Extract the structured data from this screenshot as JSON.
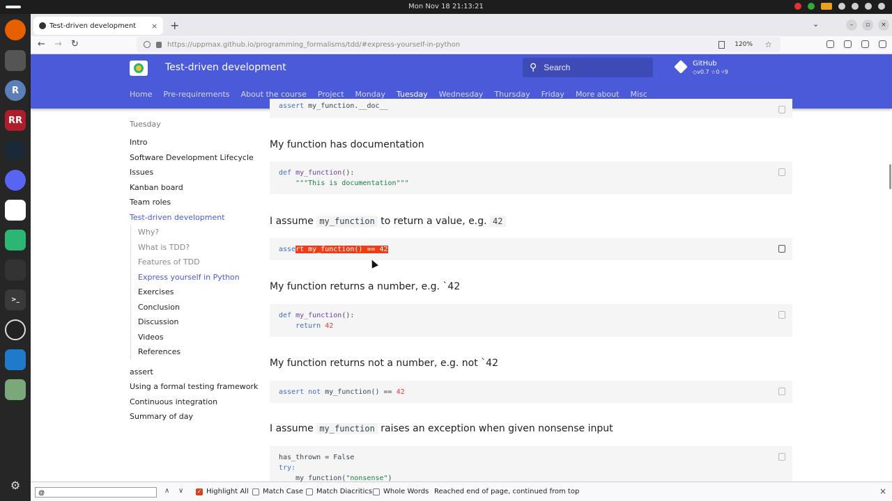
{
  "system": {
    "clock": "Mon Nov 18  21:13:21"
  },
  "browser": {
    "tab_title": "Test-driven development",
    "tab_close": "×",
    "new_tab": "+",
    "url": "https://uppmax.github.io/programming_formalisms/tdd/#express-yourself-in-python",
    "zoom": "120%",
    "tab_list": "⌄",
    "back": "←",
    "forward": "→",
    "reload": "↻",
    "minimize": "–",
    "maximize": "▫",
    "close": "×"
  },
  "site": {
    "title": "Test-driven development",
    "search_placeholder": "Search",
    "repo_name": "GitHub",
    "repo_stats": "◇v0.7  ☆0  ⑂9",
    "nav": [
      "Home",
      "Pre-requirements",
      "About the course",
      "Project",
      "Monday",
      "Tuesday",
      "Wednesday",
      "Thursday",
      "Friday",
      "More about",
      "Misc"
    ]
  },
  "sidebar": {
    "section": "Tuesday",
    "items": [
      "Intro",
      "Software Development Lifecycle",
      "Issues",
      "Kanban board",
      "Team roles",
      "Test-driven development"
    ],
    "subitems": [
      "Why?",
      "What is TDD?",
      "Features of TDD",
      "Express yourself in Python",
      "Exercises",
      "Conclusion",
      "Discussion",
      "Videos",
      "References"
    ],
    "after_items": [
      "assert",
      "Using a formal testing framework",
      "Continuous integration",
      "Summary of day"
    ]
  },
  "content": {
    "code0_a": "assert ",
    "code0_b": "my_function.__doc__",
    "h_doc": "My function has documentation",
    "code1_def": "def ",
    "code1_fn": "my_function",
    "code1_rest": "():",
    "code1_str": "    \"\"\"This is documentation\"\"\"",
    "h_return_a": "I assume ",
    "h_return_code": "my_function",
    "h_return_b": " to return a value, e.g. ",
    "h_return_code2": "42",
    "code2_pre": "asse",
    "code2_hl": "rt my_function() == 42",
    "h_number": "My function returns a number, e.g. `42",
    "code3_def": "def ",
    "code3_fn": "my_function",
    "code3_rest": "():",
    "code3_ret": "    return ",
    "code3_num": "42",
    "h_notnumber": "My function returns not a number, e.g. not `42",
    "code4_a": "assert not ",
    "code4_b": "my_function() == ",
    "code4_num": "42",
    "h_except_a": "I assume ",
    "h_except_code": "my_function",
    "h_except_b": " raises an exception when given nonsense input",
    "code5_l1": "has_thrown = False",
    "code5_l2": "try:",
    "code5_l3a": "    my_function(",
    "code5_l3b": "\"nonsense\"",
    "code5_l3c": ")"
  },
  "findbar": {
    "query": "@",
    "prev": "∧",
    "next": "∨",
    "highlight_all": "Highlight All",
    "highlight_all_checked": true,
    "match_case": "Match Case",
    "match_diacritics": "Match Diacritics",
    "whole_words": "Whole Words",
    "status": "Reached end of page, continued from top",
    "close": "×"
  },
  "colors": {
    "header": "#4a5ad9",
    "highlight": "#ef3d15",
    "accent": "#4a5ad9"
  }
}
